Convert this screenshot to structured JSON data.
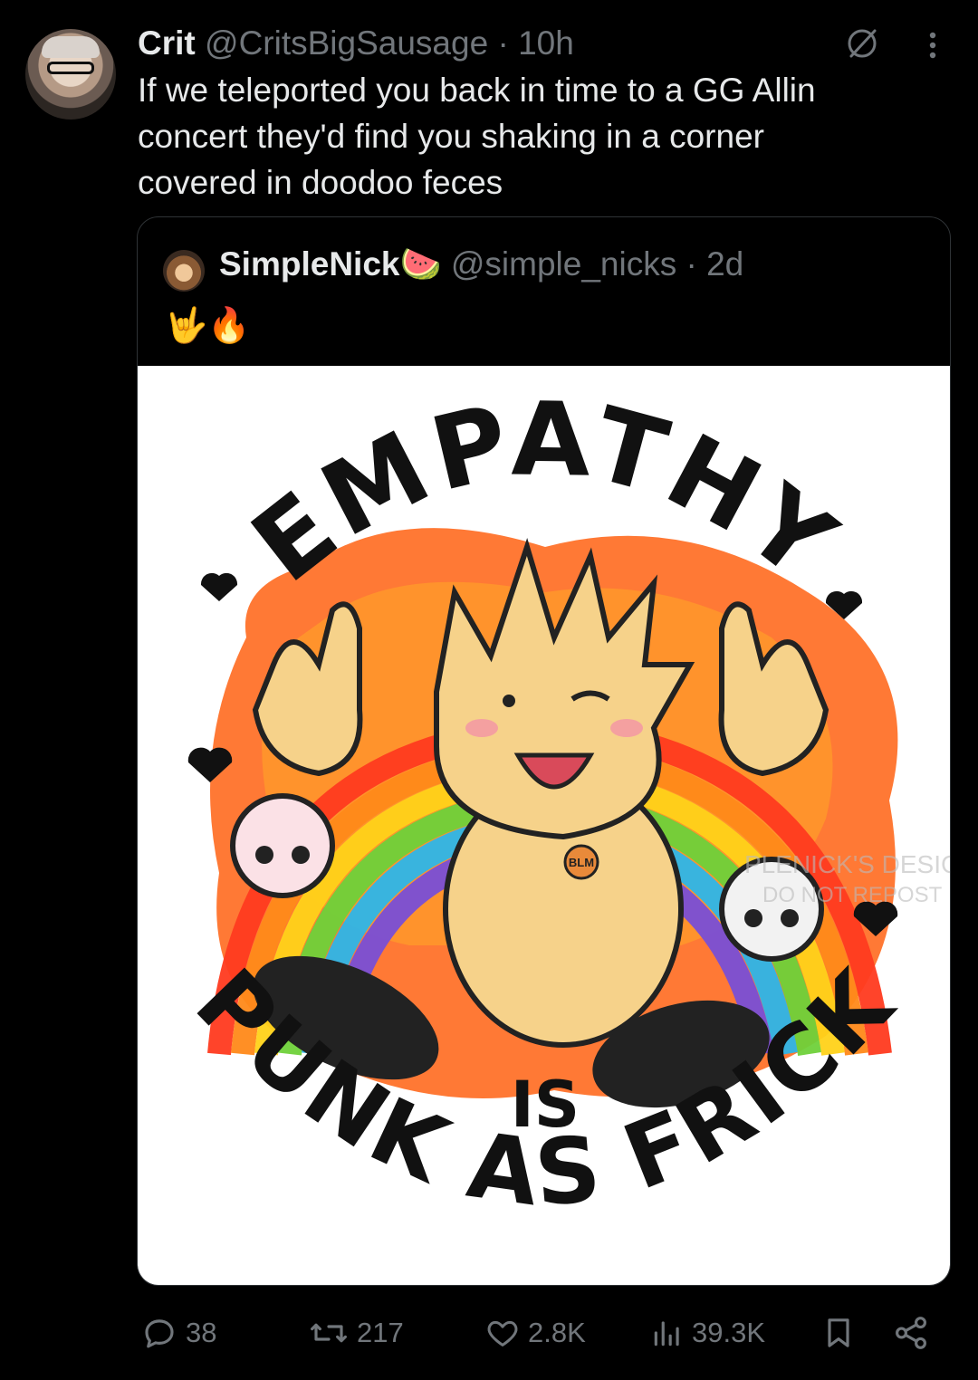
{
  "tweet": {
    "display_name": "Crit",
    "handle": "@CritsBigSausage",
    "separator": "·",
    "time": "10h",
    "lines": [
      "If we teleported you back in time to a GG Allin",
      "concert they'd find you shaking in a corner",
      "covered in doodoo feces"
    ]
  },
  "quote": {
    "display_name": "SimpleNick",
    "name_emoji": "🍉",
    "handle": "@simple_nicks",
    "separator": "·",
    "time": "2d",
    "text": "🤟🔥",
    "image": {
      "top_text": "EMPATHY",
      "middle_text": "IS",
      "bottom_text": "PUNK AS FRICK",
      "watermark_line1": "PLENICK'S DESIGN",
      "watermark_line2": "DO NOT REPOST",
      "badge_text": "BLM",
      "rainbow_colors": [
        "#ff3b1f",
        "#ff8a1a",
        "#ffd21a",
        "#6fd13a",
        "#2fb6e8",
        "#7a4fd6"
      ]
    }
  },
  "actions": {
    "replies": "38",
    "reposts": "217",
    "likes": "2.8K",
    "views": "39.3K"
  },
  "icons": [
    "grok-icon",
    "more-icon",
    "reply-icon",
    "repost-icon",
    "like-icon",
    "views-icon",
    "bookmark-icon",
    "share-icon"
  ]
}
